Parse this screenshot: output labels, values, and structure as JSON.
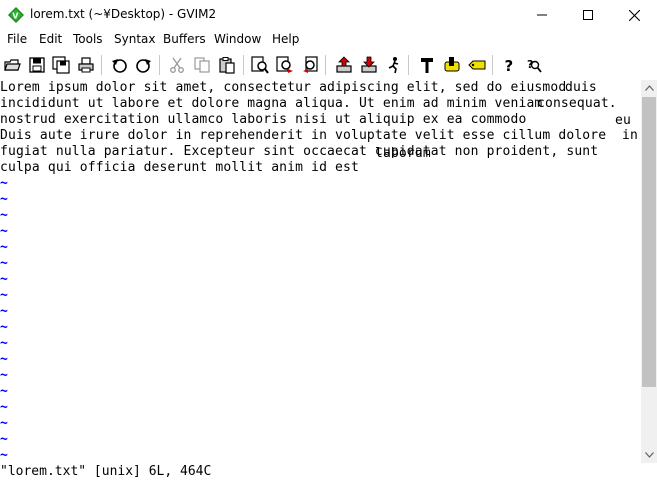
{
  "window": {
    "title": "lorem.txt (~¥Desktop) - GVIM2",
    "icon": "gvim-icon",
    "controls": {
      "minimize": "minimize-icon",
      "maximize": "maximize-icon",
      "close": "close-icon"
    }
  },
  "menu": {
    "file": "File",
    "edit": "Edit",
    "tools": "Tools",
    "syntax": "Syntax",
    "buffers": "Buffers",
    "window": "Window",
    "help": "Help"
  },
  "toolbar": {
    "icons": [
      "open-icon",
      "save-icon",
      "save-all-icon",
      "print-icon",
      "undo-icon",
      "redo-icon",
      "cut-icon",
      "copy-icon",
      "paste-icon",
      "find-replace-icon",
      "find-next-icon",
      "find-previous-icon",
      "load-session-icon",
      "save-session-icon",
      "run-script-icon",
      "make-icon",
      "build-tags-icon",
      "jump-to-tag-icon",
      "help-icon",
      "find-help-icon"
    ]
  },
  "editor": {
    "lines": [
      "Lorem ipsum dolor sit amet, consectetur adipiscing elit, sed do eiusmod",
      "incididunt ut labore et dolore magna aliqua. Ut enim ad minim veniam",
      "nostrud exercitation ullamco laboris nisi ut aliquip ex ea commodo",
      "Duis aute irure dolor in reprehenderit in voluptate velit esse cillum dolore",
      "fugiat nulla pariatur. Excepteur sint occaecat cupidatat non proident, sunt",
      "culpa qui officia deserunt mollit anim id est"
    ],
    "overlays": [
      {
        "text": "duis",
        "line": 0
      },
      {
        "text": "consequat.",
        "line": 1
      },
      {
        "text": "eu",
        "line": 2
      },
      {
        "text": "in",
        "line": 3
      },
      {
        "text": "laborum",
        "line": 4
      }
    ],
    "tilde": "~",
    "empty_line_count": 18
  },
  "status": {
    "command_line": "\"lorem.txt\" [unix] 6L, 464C"
  }
}
